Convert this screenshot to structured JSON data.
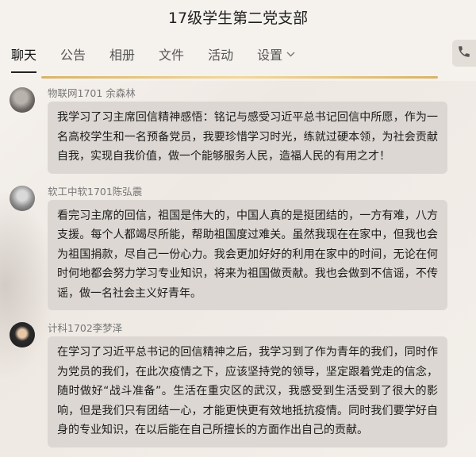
{
  "header": {
    "title": "17级学生第二党支部"
  },
  "tabs": [
    {
      "label": "聊天"
    },
    {
      "label": "公告"
    },
    {
      "label": "相册"
    },
    {
      "label": "文件"
    },
    {
      "label": "活动"
    },
    {
      "label": "设置"
    }
  ],
  "messages": [
    {
      "sender": "物联网1701  余森林",
      "text": "我学习了习主席回信精神感悟：铭记与感受习近平总书记回信中所愿，作为一名高校学生和一名预备党员，我要珍惜学习时光，练就过硬本领，为社会贡献自我，实现自我价值，做一个能够服务人民，造福人民的有用之才！"
    },
    {
      "sender": "软工中软1701陈弘震",
      "text": "看完习主席的回信，祖国是伟大的，中国人真的是挺团结的，一方有难，八方支援。每个人都竭尽所能，帮助祖国度过难关。虽然我现在在家中，但我也会为祖国捐款，尽自己一份心力。我会更加好好的利用在家中的时间，无论在何时何地都会努力学习专业知识，将来为祖国做贡献。我也会做到不信谣，不传谣，做一名社会主义好青年。"
    },
    {
      "sender": "计科1702李梦泽",
      "text": "在学习了习近平总书记的回信精神之后，我学习到了作为青年的我们，同时作为党员的我们，在此次疫情之下，应该坚持党的领导，坚定跟着党走的信念，随时做好“战斗准备”。生活在重灾区的武汉，我感受到生活受到了很大的影响，但是我们只有团结一心，才能更快更有效地抵抗疫情。同时我们要学好自身的专业知识，在以后能在自己所擅长的方面作出自己的贡献。"
    }
  ],
  "icons": {
    "settings_chevron": "chevron-down-icon",
    "call": "phone-icon"
  },
  "colors": {
    "bubble": "#dcd7d2",
    "accent_line": "#d9b36a"
  }
}
